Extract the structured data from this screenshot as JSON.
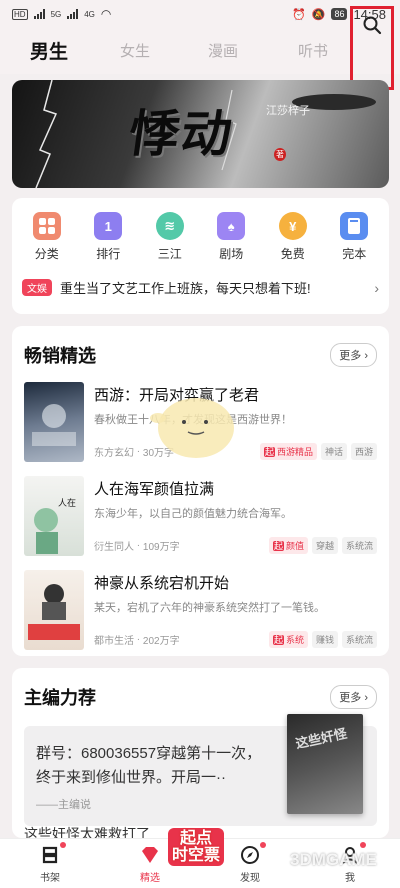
{
  "status": {
    "left_tags": [
      "HD",
      "HD"
    ],
    "signal_labels": [
      "5G",
      "4G"
    ],
    "battery": "86",
    "time": "14:58"
  },
  "top_nav": {
    "tabs": [
      "男生",
      "女生",
      "漫画",
      "听书"
    ],
    "active_tab": "男生"
  },
  "banner": {
    "title": "悸动",
    "author": "江莎梓子",
    "seal": "著"
  },
  "categories": [
    {
      "label": "分类",
      "icon": "grid-icon",
      "color": "#f08a6f"
    },
    {
      "label": "排行",
      "icon": "rank-icon",
      "glyph": "1",
      "color": "#8d7ef0"
    },
    {
      "label": "三江",
      "icon": "wave-icon",
      "glyph": "≋",
      "color": "#53c9a8"
    },
    {
      "label": "剧场",
      "icon": "theater-icon",
      "glyph": "♠",
      "color": "#9c85f3"
    },
    {
      "label": "免费",
      "icon": "yuan-icon",
      "glyph": "¥",
      "color": "#f6b13e"
    },
    {
      "label": "完本",
      "icon": "book-icon",
      "color": "#5a8df0"
    }
  ],
  "notice": {
    "tag": "文娱",
    "text": "重生当了文艺工作上班族，每天只想着下班!"
  },
  "bestsellers": {
    "title": "畅销精选",
    "more": "更多",
    "books": [
      {
        "title": "西游：开局对弈赢了老君",
        "desc": "春秋做王十八年，才发现这是西游世界！",
        "genre": "东方玄幻",
        "words": "30万字",
        "tag_qi": "起",
        "tag_main": "西游精品",
        "tags": [
          "神话",
          "西游"
        ]
      },
      {
        "title": "人在海军颜值拉满",
        "desc": "东海少年，以自己的颜值魅力统合海军。",
        "genre": "衍生同人",
        "words": "109万字",
        "tag_qi": "起",
        "tag_main": "颜值",
        "tags": [
          "穿越",
          "系统流"
        ]
      },
      {
        "title": "神豪从系统宕机开始",
        "desc": "某天，宕机了六年的神豪系统突然打了一笔钱。",
        "genre": "都市生活",
        "words": "202万字",
        "tag_qi": "起",
        "tag_main": "系统",
        "tags": [
          "赚钱",
          "系统流"
        ]
      }
    ]
  },
  "editor_picks": {
    "title": "主编力荐",
    "more": "更多",
    "text": "群号：680036557穿越第十一次，终于来到修仙世界。开局一··",
    "by": "——主编说",
    "next_title": "这些奸怪太难救打了",
    "cover_text": "这些奸怪"
  },
  "bottom_nav": [
    {
      "label": "书架",
      "icon": "bookshelf-icon"
    },
    {
      "label": "精选",
      "icon": "diamond-icon",
      "active": true
    },
    {
      "label": "发现",
      "icon": "compass-icon"
    },
    {
      "label": "我",
      "icon": "profile-icon"
    }
  ],
  "promo": "起点\n时空票",
  "watermark": "3DMGAME"
}
